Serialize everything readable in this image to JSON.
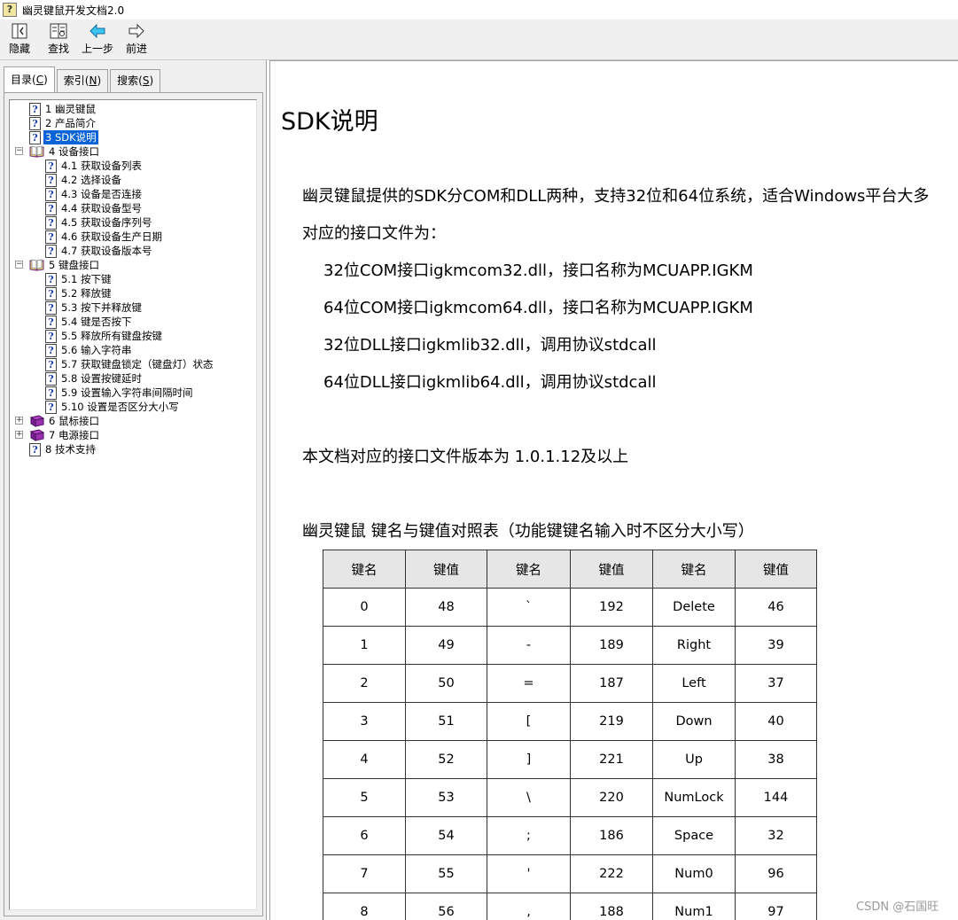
{
  "window": {
    "title": "幽灵键鼠开发文档2.0"
  },
  "toolbar": {
    "buttons": [
      {
        "label": "隐藏",
        "icon": "hide-icon"
      },
      {
        "label": "查找",
        "icon": "find-icon"
      },
      {
        "label": "上一步",
        "icon": "back-arrow-icon"
      },
      {
        "label": "前进",
        "icon": "forward-arrow-icon"
      }
    ]
  },
  "tabs": [
    {
      "label": "目录",
      "accel": "C",
      "active": true
    },
    {
      "label": "索引",
      "accel": "N",
      "active": false
    },
    {
      "label": "搜索",
      "accel": "S",
      "active": false
    }
  ],
  "tree": [
    {
      "text": "1 幽灵键鼠",
      "level": 0,
      "icon": "help-page-icon"
    },
    {
      "text": "2 产品简介",
      "level": 0,
      "icon": "help-page-icon"
    },
    {
      "text": "3 SDK说明",
      "level": 0,
      "icon": "help-page-icon",
      "selected": true
    },
    {
      "text": "4 设备接口",
      "level": 0,
      "icon": "open-book-icon",
      "expander": "⊟"
    },
    {
      "text": "4.1 获取设备列表",
      "level": 1,
      "icon": "help-page-icon"
    },
    {
      "text": "4.2 选择设备",
      "level": 1,
      "icon": "help-page-icon"
    },
    {
      "text": "4.3 设备是否连接",
      "level": 1,
      "icon": "help-page-icon"
    },
    {
      "text": "4.4 获取设备型号",
      "level": 1,
      "icon": "help-page-icon"
    },
    {
      "text": "4.5 获取设备序列号",
      "level": 1,
      "icon": "help-page-icon"
    },
    {
      "text": "4.6 获取设备生产日期",
      "level": 1,
      "icon": "help-page-icon"
    },
    {
      "text": "4.7 获取设备版本号",
      "level": 1,
      "icon": "help-page-icon"
    },
    {
      "text": "5 键盘接口",
      "level": 0,
      "icon": "open-book-icon",
      "expander": "⊟"
    },
    {
      "text": "5.1 按下键",
      "level": 1,
      "icon": "help-page-icon"
    },
    {
      "text": "5.2 释放键",
      "level": 1,
      "icon": "help-page-icon"
    },
    {
      "text": "5.3 按下并释放键",
      "level": 1,
      "icon": "help-page-icon"
    },
    {
      "text": "5.4 键是否按下",
      "level": 1,
      "icon": "help-page-icon"
    },
    {
      "text": "5.5 释放所有键盘按键",
      "level": 1,
      "icon": "help-page-icon"
    },
    {
      "text": "5.6 输入字符串",
      "level": 1,
      "icon": "help-page-icon"
    },
    {
      "text": "5.7 获取键盘锁定（键盘灯）状态",
      "level": 1,
      "icon": "help-page-icon"
    },
    {
      "text": "5.8 设置按键延时",
      "level": 1,
      "icon": "help-page-icon"
    },
    {
      "text": "5.9 设置输入字符串间隔时间",
      "level": 1,
      "icon": "help-page-icon"
    },
    {
      "text": "5.10 设置是否区分大小写",
      "level": 1,
      "icon": "help-page-icon"
    },
    {
      "text": "6 鼠标接口",
      "level": 0,
      "icon": "closed-book-icon",
      "expander": "⊞"
    },
    {
      "text": "7 电源接口",
      "level": 0,
      "icon": "closed-book-icon",
      "expander": "⊞"
    },
    {
      "text": "8 技术支持",
      "level": 0,
      "icon": "help-page-icon"
    }
  ],
  "content": {
    "title": "SDK说明",
    "intro": "幽灵键鼠提供的SDK分COM和DLL两种，支持32位和64位系统，适合Windows平台大多",
    "files_intro": "对应的接口文件为：",
    "files": [
      "32位COM接口igkmcom32.dll，接口名称为MCUAPP.IGKM",
      "64位COM接口igkmcom64.dll，接口名称为MCUAPP.IGKM",
      "32位DLL接口igkmlib32.dll，调用协议stdcall",
      "64位DLL接口igkmlib64.dll，调用协议stdcall"
    ],
    "version_note": "本文档对应的接口文件版本为 1.0.1.12及以上",
    "table_caption": "幽灵键鼠 键名与键值对照表（功能键键名输入时不区分大小写）",
    "table": {
      "headers": [
        "键名",
        "键值",
        "键名",
        "键值",
        "键名",
        "键值"
      ],
      "rows": [
        [
          "0",
          "48",
          "`",
          "192",
          "Delete",
          "46"
        ],
        [
          "1",
          "49",
          "-",
          "189",
          "Right",
          "39"
        ],
        [
          "2",
          "50",
          "=",
          "187",
          "Left",
          "37"
        ],
        [
          "3",
          "51",
          "[",
          "219",
          "Down",
          "40"
        ],
        [
          "4",
          "52",
          "]",
          "221",
          "Up",
          "38"
        ],
        [
          "5",
          "53",
          "\\",
          "220",
          "NumLock",
          "144"
        ],
        [
          "6",
          "54",
          ";",
          "186",
          "Space",
          "32"
        ],
        [
          "7",
          "55",
          "'",
          "222",
          "Num0",
          "96"
        ],
        [
          "8",
          "56",
          ",",
          "188",
          "Num1",
          "97"
        ]
      ]
    }
  },
  "watermark": "CSDN @石国旺",
  "colors": {
    "selection": "#0a64d8",
    "table_header_bg": "#e6e6e6",
    "panel_bg": "#f0f0f0"
  }
}
